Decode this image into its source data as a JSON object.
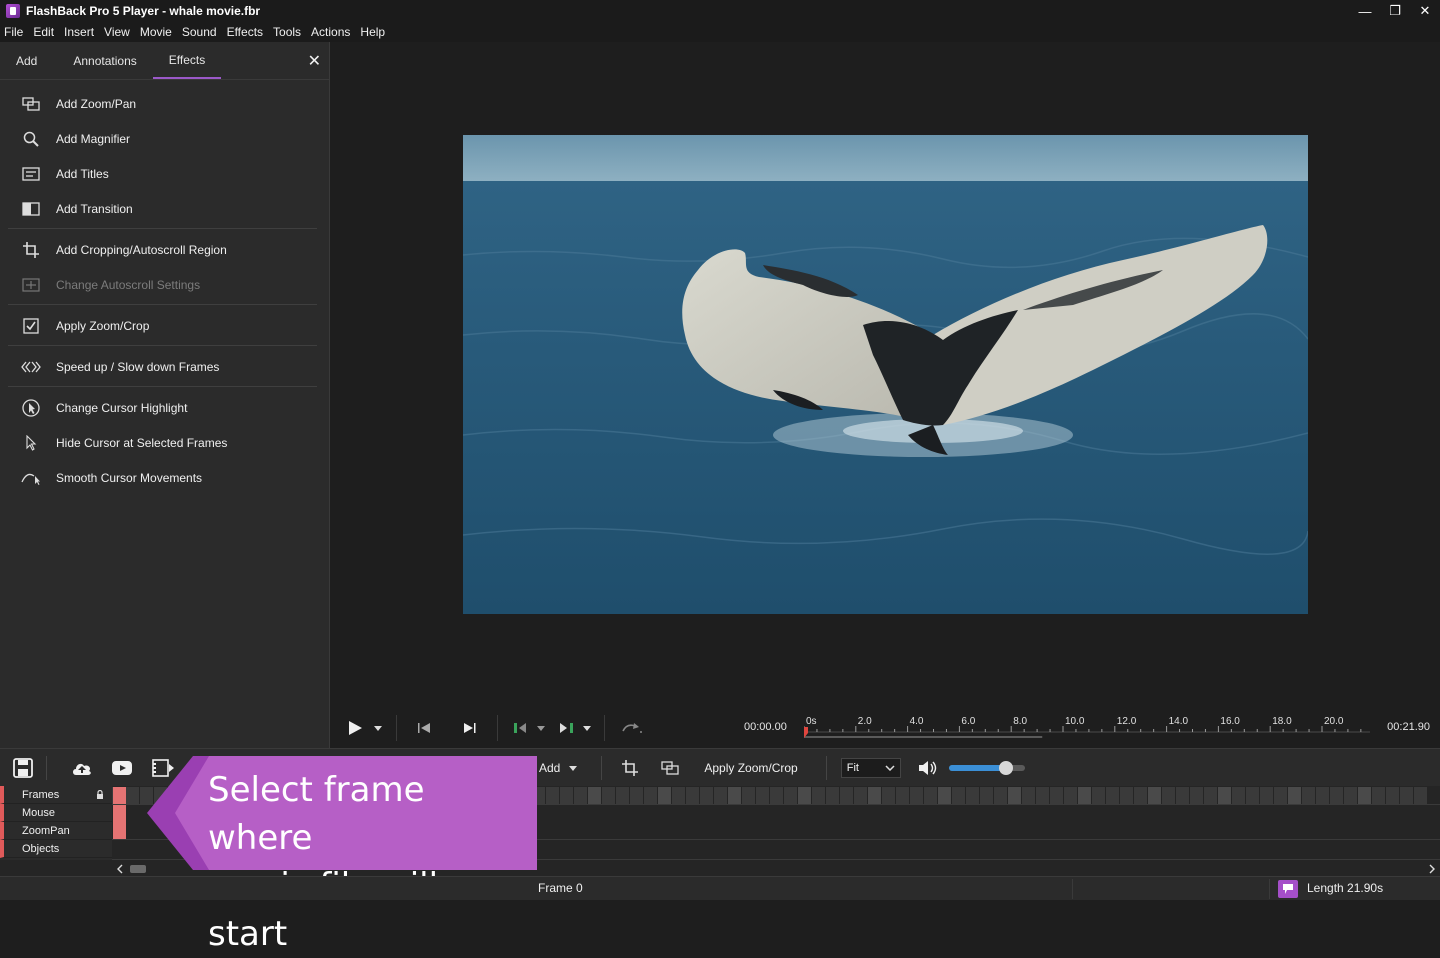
{
  "window": {
    "title": "FlashBack Pro 5 Player - whale movie.fbr",
    "minimize": "—",
    "maximize": "❐",
    "close": "✕"
  },
  "menu": [
    "File",
    "Edit",
    "Insert",
    "View",
    "Movie",
    "Sound",
    "Effects",
    "Tools",
    "Actions",
    "Help"
  ],
  "panel": {
    "tabs": [
      {
        "label": "Add",
        "active": false
      },
      {
        "label": "Annotations",
        "active": false
      },
      {
        "label": "Effects",
        "active": true
      }
    ],
    "close": "✕",
    "effects": [
      {
        "label": "Add Zoom/Pan",
        "icon": "zoom-pan-icon",
        "enabled": true
      },
      {
        "label": "Add Magnifier",
        "icon": "magnifier-icon",
        "enabled": true
      },
      {
        "label": "Add Titles",
        "icon": "titles-icon",
        "enabled": true
      },
      {
        "label": "Add Transition",
        "icon": "transition-icon",
        "enabled": true
      },
      {
        "label": "Add Cropping/Autoscroll Region",
        "icon": "crop-icon",
        "enabled": true
      },
      {
        "label": "Change Autoscroll Settings",
        "icon": "autoscroll-icon",
        "enabled": false
      },
      {
        "label": "Apply Zoom/Crop",
        "icon": "checkbox-icon",
        "enabled": true
      },
      {
        "label": "Speed up / Slow down Frames",
        "icon": "speed-icon",
        "enabled": true
      },
      {
        "label": "Change Cursor Highlight",
        "icon": "cursor-highlight-icon",
        "enabled": true
      },
      {
        "label": "Hide Cursor at Selected Frames",
        "icon": "cursor-icon",
        "enabled": true
      },
      {
        "label": "Smooth Cursor Movements",
        "icon": "smooth-cursor-icon",
        "enabled": true
      }
    ]
  },
  "transport": {
    "current_time": "00:00.00",
    "length": "00:21.90",
    "ruler_ticks": [
      "0s",
      "2.0",
      "4.0",
      "6.0",
      "8.0",
      "10.0",
      "12.0",
      "14.0",
      "16.0",
      "18.0",
      "20.0"
    ],
    "playhead_seconds": 0,
    "total_seconds": 21.9
  },
  "toolbar": {
    "add_label": "Add",
    "apply_label": "Apply Zoom/Crop",
    "fit_value": "Fit",
    "volume_level": 0.75
  },
  "timeline": {
    "tracks": [
      "Frames",
      "Mouse",
      "ZoomPan",
      "Objects"
    ]
  },
  "callout": {
    "line1": "Select frame where",
    "line2": "music file will start"
  },
  "status": {
    "frame": "Frame 0",
    "length": "Length 21.90s"
  },
  "colors": {
    "accent": "#9b59c9",
    "callout": "#b65fc6",
    "track_marker": "#e05a5a",
    "volume": "#3b8fd6"
  }
}
